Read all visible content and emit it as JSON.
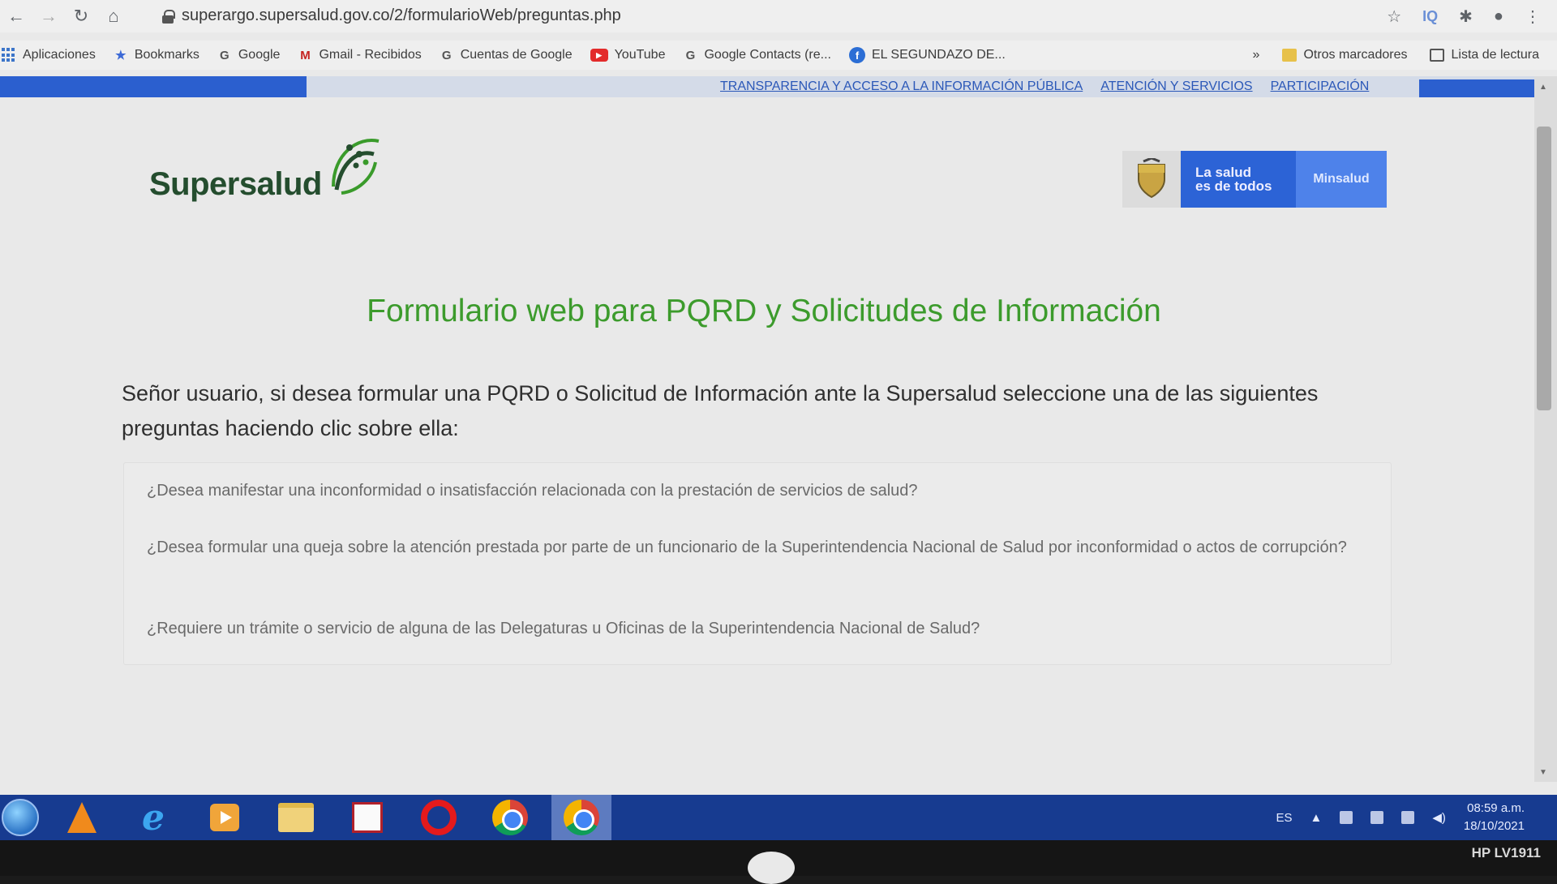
{
  "browser": {
    "url": "superargo.supersalud.gov.co/2/formularioWeb/preguntas.php",
    "bookmarks": [
      {
        "label": "Aplicaciones",
        "icon": "apps-grid-icon"
      },
      {
        "label": "Bookmarks",
        "icon": "star-icon"
      },
      {
        "label": "Google",
        "icon": "google-icon"
      },
      {
        "label": "Gmail - Recibidos",
        "icon": "gmail-icon"
      },
      {
        "label": "Cuentas de Google",
        "icon": "google-icon"
      },
      {
        "label": "YouTube",
        "icon": "youtube-icon"
      },
      {
        "label": "Google Contacts (re...",
        "icon": "google-icon"
      },
      {
        "label": "EL SEGUNDAZO DE...",
        "icon": "facebook-icon"
      }
    ],
    "overflow": "»",
    "other_bookmarks": "Otros marcadores",
    "reading_list": "Lista de lectura",
    "extension_label": "IQ"
  },
  "page": {
    "topnav": [
      "TRANSPARENCIA Y ACCESO A LA INFORMACIÓN PÚBLICA",
      "ATENCIÓN Y SERVICIOS",
      "PARTICIPACIÓN"
    ],
    "logo_text": "Supersalud",
    "gov_badge": {
      "line1": "La salud",
      "line2": "es de todos",
      "ministry": "Minsalud"
    },
    "title": "Formulario web para PQRD y Solicitudes de Información",
    "intro": "Señor usuario, si desea formular una PQRD o Solicitud de Información ante la Supersalud seleccione una de las siguientes preguntas haciendo clic sobre ella:",
    "questions": [
      "¿Desea manifestar una inconformidad o insatisfacción relacionada con la prestación de servicios de salud?",
      "¿Desea formular una queja sobre la atención prestada por parte de un funcionario de la Superintendencia Nacional de Salud por inconformidad o actos de corrupción?",
      "¿Requiere un trámite o servicio de alguna de las Delegaturas u Oficinas de la Superintendencia Nacional de Salud?"
    ],
    "colors": {
      "title_green": "#3c9b2c",
      "link_blue": "#2b58b8",
      "nav_blue": "#2b5fcf"
    }
  },
  "taskbar": {
    "apps": [
      "start-orb",
      "vlc",
      "internet-explorer",
      "media-player",
      "file-explorer",
      "chart-app",
      "opera",
      "chrome",
      "chrome-profile"
    ],
    "language": "ES",
    "time": "08:59 a.m.",
    "date": "18/10/2021"
  },
  "monitor": {
    "model": "HP LV1911"
  }
}
